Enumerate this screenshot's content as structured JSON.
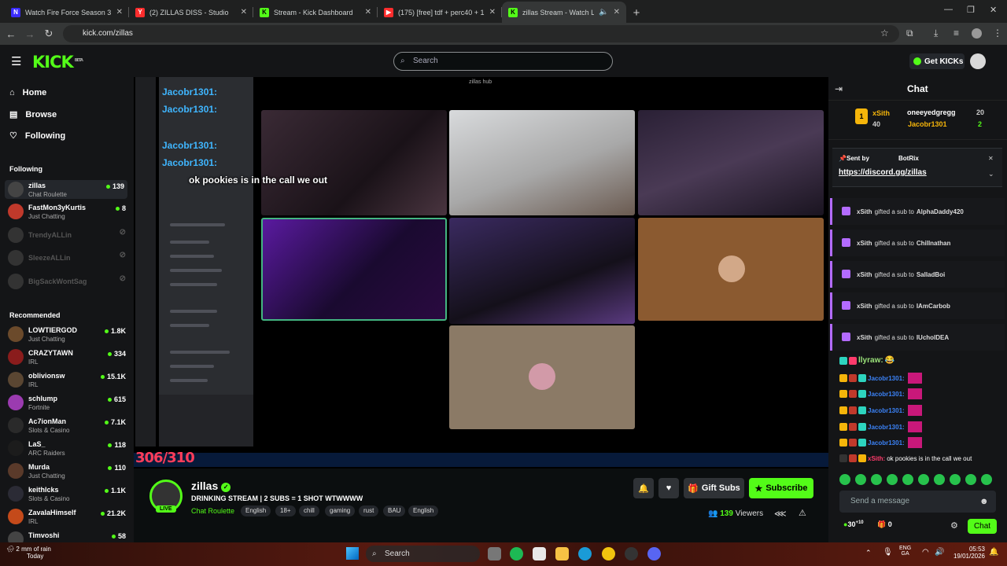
{
  "browser": {
    "tabs": [
      {
        "title": "Watch Fire Force Season 3 Engl",
        "icon_color": "#3b2cff",
        "icon_letter": "N"
      },
      {
        "title": "(2) ZILLAS DISS - Studio",
        "icon_color": "#ff2d2d",
        "icon_letter": "Y"
      },
      {
        "title": "Stream - Kick Dashboard",
        "icon_color": "#53fc18",
        "icon_letter": "K"
      },
      {
        "title": "(175) [free] tdf + perc40 + 1one",
        "icon_color": "#ff2d2d",
        "icon_letter": "▶"
      },
      {
        "title": "zillas Stream - Watch Live o",
        "icon_color": "#53fc18",
        "icon_letter": "K"
      }
    ],
    "url": "kick.com/zillas"
  },
  "header": {
    "logo": "KICK",
    "logo_sup": "BETA",
    "search_placeholder": "Search",
    "get_kicks": "Get KICKs"
  },
  "sidebar": {
    "nav": [
      {
        "label": "Home",
        "icon": "home-icon"
      },
      {
        "label": "Browse",
        "icon": "browse-icon"
      },
      {
        "label": "Following",
        "icon": "heart-icon"
      }
    ],
    "following_title": "Following",
    "following": [
      {
        "name": "zillas",
        "sub": "Chat Roulette",
        "viewers": "139",
        "color": "#444",
        "online": true
      },
      {
        "name": "FastMon3yKurtis",
        "sub": "Just Chatting",
        "viewers": "8",
        "color": "#c0392b",
        "online": true
      },
      {
        "name": "TrendyALLin",
        "sub": "",
        "viewers": "",
        "color": "#333",
        "online": false
      },
      {
        "name": "SleezeALLin",
        "sub": "",
        "viewers": "",
        "color": "#333",
        "online": false
      },
      {
        "name": "BigSackWontSag",
        "sub": "",
        "viewers": "",
        "color": "#333",
        "online": false
      }
    ],
    "recommended_title": "Recommended",
    "recommended": [
      {
        "name": "LOWTIERGOD",
        "sub": "Just Chatting",
        "viewers": "1.8K",
        "color": "#6b4a2b"
      },
      {
        "name": "CRAZYTAWN",
        "sub": "IRL",
        "viewers": "334",
        "color": "#8a1c1c"
      },
      {
        "name": "oblivionsw",
        "sub": "IRL",
        "viewers": "15.1K",
        "color": "#5a4632"
      },
      {
        "name": "schlump",
        "sub": "Fortnite",
        "viewers": "615",
        "color": "#9b3bb0"
      },
      {
        "name": "Ac7ionMan",
        "sub": "Slots & Casino",
        "viewers": "7.1K",
        "color": "#2a2a2a"
      },
      {
        "name": "LaS_",
        "sub": "ARC Raiders",
        "viewers": "118",
        "color": "#1c1c1c"
      },
      {
        "name": "Murda",
        "sub": "Just Chatting",
        "viewers": "110",
        "color": "#5a3a2a"
      },
      {
        "name": "keithlcks",
        "sub": "Slots & Casino",
        "viewers": "1.1K",
        "color": "#2b2b35"
      },
      {
        "name": "ZavalaHimself",
        "sub": "IRL",
        "viewers": "21.2K",
        "color": "#c44a1a"
      },
      {
        "name": "Timvoshi",
        "sub": "",
        "viewers": "58",
        "color": "#444"
      }
    ]
  },
  "video": {
    "caption": "ok pookies is in the call we out",
    "sub_counter": "306/310",
    "discord_server": "zillas hub",
    "overlay_users": [
      "Jacobr1301:",
      "Jacobr1301:",
      "Jacobr1301:",
      "Jacobr1301:"
    ]
  },
  "stream": {
    "name": "zillas",
    "live": "LIVE",
    "title": "DRINKING STREAM | 2 SUBS = 1 SHOT WTWWWW",
    "category": "Chat Roulette",
    "tags": [
      "English",
      "18+",
      "chill",
      "gaming",
      "rust",
      "BAU",
      "English"
    ],
    "gift_subs": "Gift Subs",
    "subscribe": "Subscribe",
    "viewers_count": "139",
    "viewers_label": "Viewers"
  },
  "chat": {
    "title": "Chat",
    "leaderboard": [
      {
        "rank": "1",
        "name": "xSith",
        "value": "40"
      },
      {
        "name": "oneeyedgregg",
        "value": "20"
      },
      {
        "name": "Jacobr1301",
        "value": "2"
      }
    ],
    "pinned": {
      "sent_by": "Sent by",
      "bot": "BotRix",
      "link": "https://discord.gg/zillas"
    },
    "gifts": [
      {
        "from": "xSith",
        "text": "gifted a sub to",
        "to": "AlphaDaddy420"
      },
      {
        "from": "xSith",
        "text": "gifted a sub to",
        "to": "Chillnathan"
      },
      {
        "from": "xSith",
        "text": "gifted a sub to",
        "to": "SalladBoi"
      },
      {
        "from": "xSith",
        "text": "gifted a sub to",
        "to": "IAmCarbob"
      },
      {
        "from": "xSith",
        "text": "gifted a sub to",
        "to": "IUcholDEA"
      }
    ],
    "messages": [
      {
        "user": "llyraw:",
        "text": "😂",
        "color": "#9be37a"
      },
      {
        "user": "Jacobr1301:",
        "text": "",
        "color": "#3b82f6"
      },
      {
        "user": "Jacobr1301:",
        "text": "",
        "color": "#3b82f6"
      },
      {
        "user": "Jacobr1301:",
        "text": "",
        "color": "#3b82f6"
      },
      {
        "user": "Jacobr1301:",
        "text": "",
        "color": "#3b82f6"
      },
      {
        "user": "Jacobr1301:",
        "text": "",
        "color": "#3b82f6"
      },
      {
        "user": "xSith:",
        "text": "ok pookies is in the call we out",
        "color": "#ff3b6b"
      }
    ],
    "input_placeholder": "Send a message",
    "kicks_balance": "30",
    "kicks_sup": "+10",
    "gift_count": "0",
    "send": "Chat"
  },
  "os": {
    "weather": "2 mm of rain",
    "weather_sub": "Today",
    "search": "Search",
    "lang": "ENG",
    "lang_sub": "GA",
    "time": "05:53",
    "date": "19/01/2026"
  },
  "colors": {
    "accent": "#53fc18",
    "gift_purple": "#b36bff"
  }
}
